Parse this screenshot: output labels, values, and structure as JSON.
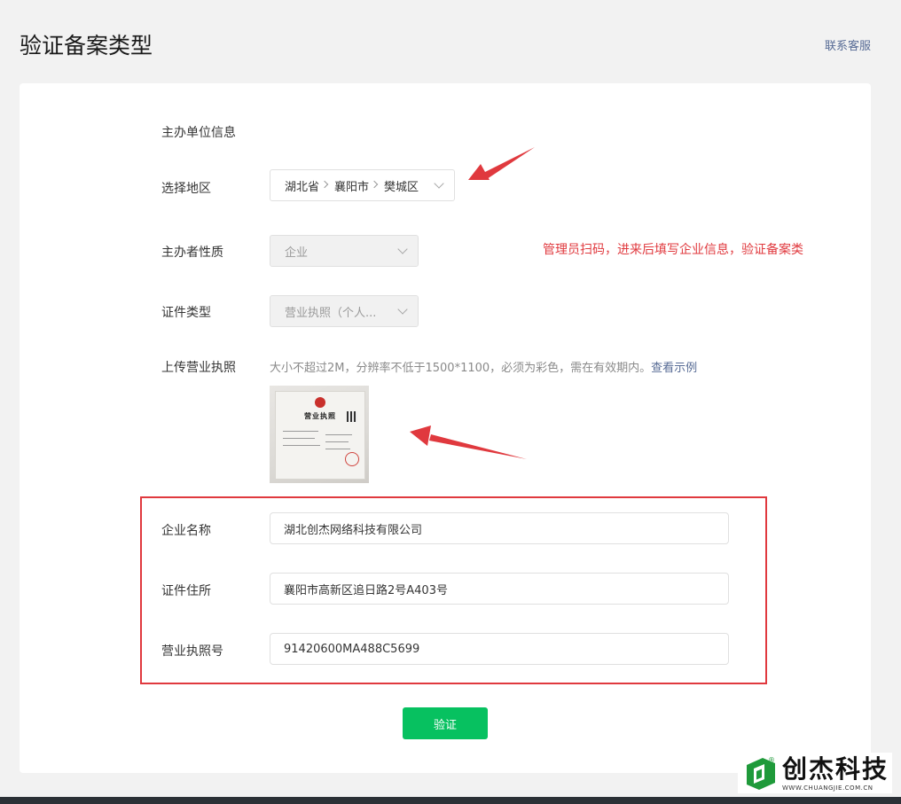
{
  "header": {
    "title": "验证备案类型",
    "contact_label": "联系客服"
  },
  "form": {
    "section_title": "主办单位信息",
    "region": {
      "label": "选择地区",
      "province": "湖北省",
      "city": "襄阳市",
      "district": "樊城区",
      "icon": "chevron-down-icon"
    },
    "organizer_type": {
      "label": "主办者性质",
      "value": "企业",
      "disabled": true
    },
    "cert_type": {
      "label": "证件类型",
      "value": "营业执照（个人...",
      "disabled": true
    },
    "upload": {
      "label": "上传营业执照",
      "hint": "大小不超过2M，分辨率不低于1500*1100，必须为彩色，需在有效期内。",
      "example_link": "查看示例",
      "thumbnail_title": "营业执照"
    },
    "company_name": {
      "label": "企业名称",
      "value": "湖北创杰网络科技有限公司"
    },
    "cert_address": {
      "label": "证件住所",
      "value": "襄阳市高新区追日路2号A403号"
    },
    "license_number": {
      "label": "营业执照号",
      "value": "91420600MA488C5699"
    },
    "submit_label": "验证"
  },
  "annotation": {
    "text": "管理员扫码，进来后填写企业信息，验证备案类"
  },
  "watermark": {
    "name": "创杰科技",
    "url": "WWW.CHUANGJIE.COM.CN",
    "registered_mark": "®"
  },
  "colors": {
    "primary": "#07c160",
    "link": "#576b95",
    "annotation_red": "#e0393e"
  }
}
